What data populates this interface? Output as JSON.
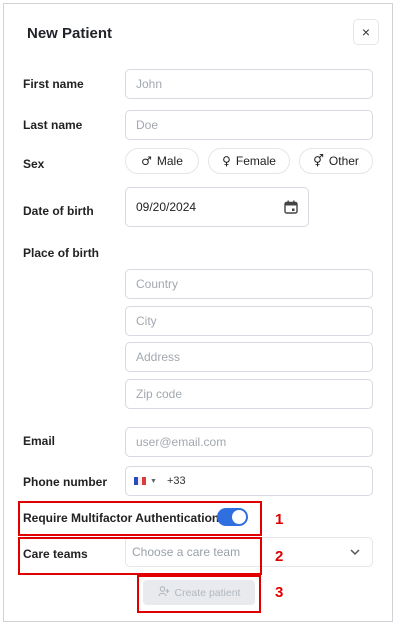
{
  "dialog": {
    "title": "New Patient",
    "close_label": "×"
  },
  "form": {
    "first_name": {
      "label": "First name",
      "placeholder": "John"
    },
    "last_name": {
      "label": "Last name",
      "placeholder": "Doe"
    },
    "sex": {
      "label": "Sex",
      "options": [
        {
          "symbol": "♂",
          "label": "Male"
        },
        {
          "symbol": "♀",
          "label": "Female"
        },
        {
          "symbol": "⚥",
          "label": "Other"
        }
      ]
    },
    "date_of_birth": {
      "label": "Date of birth",
      "value": "09/20/2024"
    },
    "place_of_birth": {
      "label": "Place of birth",
      "country": "Country",
      "city": "City",
      "address": "Address",
      "zip": "Zip code"
    },
    "email": {
      "label": "Email",
      "placeholder": "user@email.com"
    },
    "phone": {
      "label": "Phone number",
      "code": "+33"
    },
    "mfa": {
      "label": "Require Multifactor Authentication",
      "enabled": true
    },
    "care_teams": {
      "label": "Care teams",
      "placeholder": "Choose a care team"
    },
    "create_button": "Create patient"
  },
  "annotations": [
    "1",
    "2",
    "3"
  ],
  "colors": {
    "accent": "#2f6fe0",
    "annotation": "#e00000"
  }
}
